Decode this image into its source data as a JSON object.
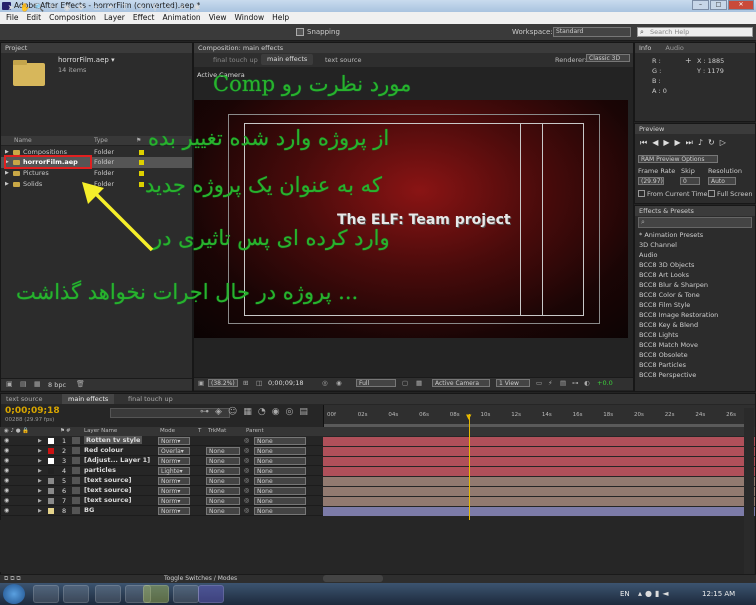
{
  "window": {
    "title": "Adobe After Effects - horrorFilm (converted).aep *"
  },
  "menu": [
    "File",
    "Edit",
    "Composition",
    "Layer",
    "Effect",
    "Animation",
    "View",
    "Window",
    "Help"
  ],
  "toolbar": {
    "snapping": "Snapping",
    "workspace_label": "Workspace:",
    "workspace_value": "Standard",
    "search_placeholder": "Search Help"
  },
  "project": {
    "tab": "Project",
    "file_name": "horrorFilm.aep",
    "file_name_arrow": "horrorFilm.aep ▾",
    "items_count": "14 items",
    "col_name": "Name",
    "col_type": "Type",
    "rows": [
      {
        "name": "Compositions",
        "type": "Folder"
      },
      {
        "name": "horrorFilm.aep",
        "type": "Folder"
      },
      {
        "name": "Pictures",
        "type": "Folder"
      },
      {
        "name": "Solids",
        "type": "Folder"
      }
    ],
    "bpc": "8 bpc"
  },
  "composition": {
    "tab": "Composition: main effects",
    "subtabs": [
      "final touch up",
      "main effects",
      "text source"
    ],
    "renderer_label": "Renderer:",
    "renderer_value": "Classic 3D",
    "active_camera": "Active Camera",
    "comp_text": "The ELF: Team project",
    "footer": {
      "zoom": "(38.2%)",
      "timecode": "0;00;09;18",
      "resolution": "Full",
      "camera": "Active Camera",
      "view": "1 View",
      "exposure": "+0.0"
    }
  },
  "info": {
    "tabs": [
      "Info",
      "Audio"
    ],
    "r": "R :",
    "g": "G :",
    "b": "B :",
    "a": "A : 0",
    "x": "X : 1885",
    "y": "Y : 1179"
  },
  "preview": {
    "tab": "Preview",
    "ram_options": "RAM Preview Options",
    "frame_rate_label": "Frame Rate",
    "skip_label": "Skip",
    "resolution_label": "Resolution",
    "frame_rate_value": "(29.97)",
    "skip_value": "0",
    "resolution_value": "Auto",
    "from_current": "From Current Time",
    "full_screen": "Full Screen"
  },
  "effects": {
    "tab": "Effects & Presets",
    "items": [
      "* Animation Presets",
      "3D Channel",
      "Audio",
      "BCC8 3D Objects",
      "BCC8 Art Looks",
      "BCC8 Blur & Sharpen",
      "BCC8 Color & Tone",
      "BCC8 Film Style",
      "BCC8 Image Restoration",
      "BCC8 Key & Blend",
      "BCC8 Lights",
      "BCC8 Match Move",
      "BCC8 Obsolete",
      "BCC8 Particles",
      "BCC8 Perspective"
    ]
  },
  "timeline": {
    "tabs": [
      "text source",
      "main effects",
      "final touch up"
    ],
    "timecode": "0;00;09;18",
    "frame_info": "00288 (29.97 fps)",
    "headers": {
      "layer_name": "Layer Name",
      "mode": "Mode",
      "t": "T",
      "trkmat": "TrkMat",
      "parent": "Parent"
    },
    "ruler": [
      "00f",
      "02s",
      "04s",
      "06s",
      "08s",
      "10s",
      "12s",
      "14s",
      "16s",
      "18s",
      "20s",
      "22s",
      "24s",
      "26s"
    ],
    "layers": [
      {
        "num": "1",
        "name": "Rotten tv style",
        "mode": "Norm▾",
        "trk": "",
        "parent": "None",
        "color": "#ffffff",
        "bar": "#b0505a"
      },
      {
        "num": "2",
        "name": "Red colour",
        "mode": "Overla▾",
        "trk": "None",
        "parent": "None",
        "color": "#cc1111",
        "bar": "#b0505a"
      },
      {
        "num": "3",
        "name": "[Adjust... Layer 1]",
        "mode": "Norm▾",
        "trk": "None",
        "parent": "None",
        "color": "#ffffff",
        "bar": "#b0505a"
      },
      {
        "num": "4",
        "name": "particles",
        "mode": "Lighte▾",
        "trk": "None",
        "parent": "None",
        "color": "#222222",
        "bar": "#b0505a"
      },
      {
        "num": "5",
        "name": "[text source]",
        "mode": "Norm▾",
        "trk": "None",
        "parent": "None",
        "color": "#8a8a8a",
        "bar": "#927a70"
      },
      {
        "num": "6",
        "name": "[text source]",
        "mode": "Norm▾",
        "trk": "None",
        "parent": "None",
        "color": "#8a8a8a",
        "bar": "#927a70"
      },
      {
        "num": "7",
        "name": "[text source]",
        "mode": "Norm▾",
        "trk": "None",
        "parent": "None",
        "color": "#8a8a8a",
        "bar": "#927a70"
      },
      {
        "num": "8",
        "name": "BG",
        "mode": "Norm▾",
        "trk": "None",
        "parent": "None",
        "color": "#e5d48c",
        "bar": "#7c7ba8"
      }
    ],
    "toggle": "Toggle Switches / Modes"
  },
  "overlay": {
    "line1": "Comp مورد نظرت رو",
    "line2": "از پروژه وارد شده تغییر بده",
    "line3": "که به عنوان یک پروژه جدید",
    "line4": "وارد کرده ای پس تاثیری در",
    "line5": "پروژه در حال اجرات نخواهد گذاشت ..."
  },
  "taskbar": {
    "lang": "EN",
    "time": "12:15 AM"
  }
}
